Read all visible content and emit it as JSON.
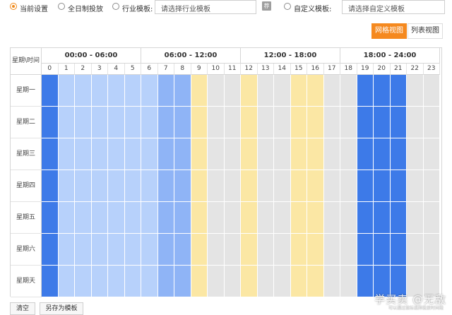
{
  "options": {
    "current": "当前设置",
    "all_day": "全日制投放",
    "industry": "行业模板:",
    "industry_placeholder": "请选择行业模板",
    "custom": "自定义模板:",
    "custom_placeholder": "请选择自定义模板",
    "selected": "current"
  },
  "view": {
    "grid": "网格视图",
    "list": "列表视图",
    "active": "grid"
  },
  "grid": {
    "corner": "星期\\时间",
    "ranges": [
      "00:00 - 06:00",
      "06:00 - 12:00",
      "12:00 - 18:00",
      "18:00 - 24:00"
    ],
    "hours": [
      "0",
      "1",
      "2",
      "3",
      "4",
      "5",
      "6",
      "7",
      "8",
      "9",
      "10",
      "11",
      "12",
      "13",
      "14",
      "15",
      "16",
      "17",
      "18",
      "19",
      "20",
      "21",
      "22",
      "23"
    ],
    "days": [
      "星期一",
      "星期二",
      "星期三",
      "星期四",
      "星期五",
      "星期六",
      "星期天"
    ],
    "hour_levels": [
      4,
      1,
      1,
      1,
      1,
      1,
      1,
      2,
      2,
      3,
      0,
      0,
      3,
      0,
      0,
      3,
      3,
      0,
      0,
      4,
      4,
      4,
      0,
      0
    ],
    "colors": [
      "#e4e4e4",
      "#b7d1fb",
      "#8fb4f6",
      "#fbe7a4",
      "#3d7ae8"
    ]
  },
  "buttons": {
    "clear": "清空",
    "save_template": "另存为模板"
  },
  "watermark": {
    "main": "学买卖 @无敌",
    "sub": "可以通过鼠标选择投放时间段"
  }
}
